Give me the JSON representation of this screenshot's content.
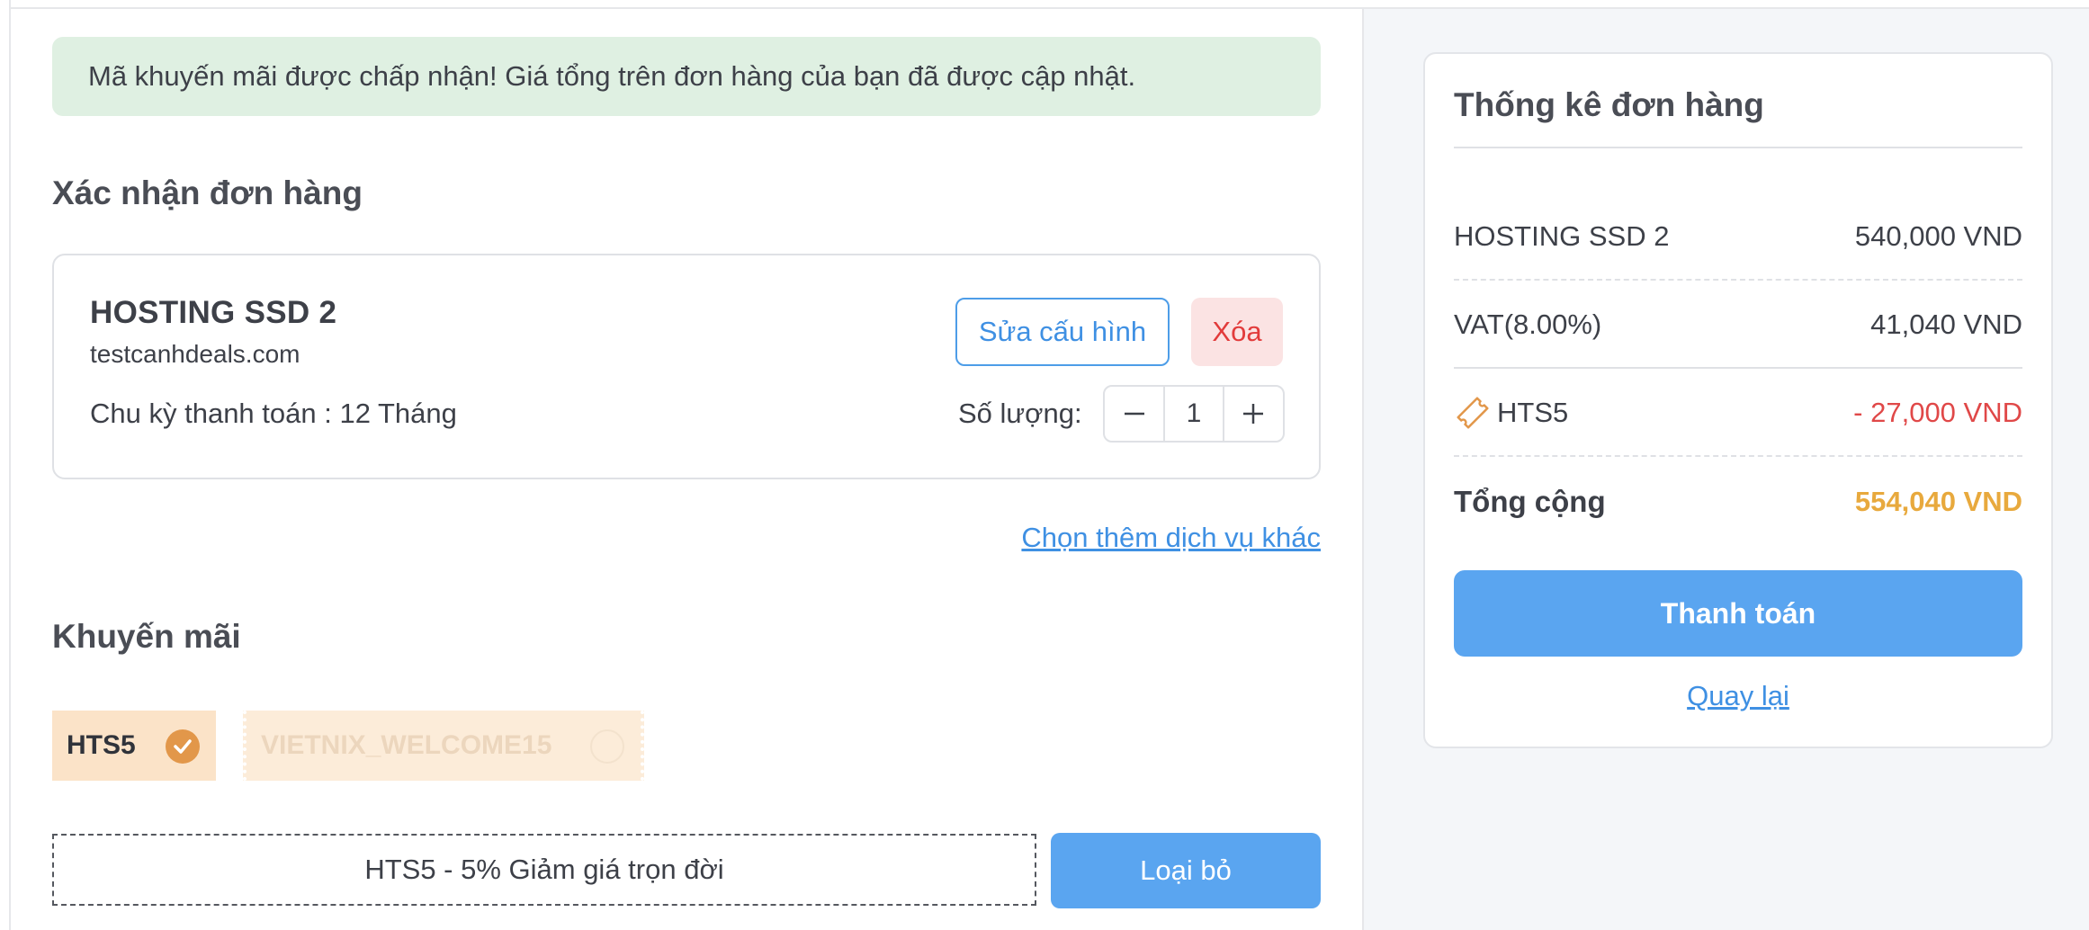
{
  "alert": {
    "message": "Mã khuyến mãi được chấp nhận! Giá tổng trên đơn hàng của bạn đã được cập nhật."
  },
  "confirm": {
    "title": "Xác nhận đơn hàng",
    "product": {
      "name": "HOSTING SSD 2",
      "domain": "testcanhdeals.com",
      "cycle": "Chu kỳ thanh toán : 12 Tháng",
      "edit_label": "Sửa cấu hình",
      "delete_label": "Xóa",
      "quantity_label": "Số lượng:",
      "quantity": "1"
    },
    "more_services": "Chọn thêm dịch vụ khác"
  },
  "promo": {
    "title": "Khuyến mãi",
    "coupons": [
      {
        "code": "HTS5",
        "selected": true
      },
      {
        "code": "VIETNIX_WELCOME15",
        "selected": false
      }
    ],
    "applied_description": "HTS5 - 5% Giảm giá trọn đời",
    "remove_label": "Loại bỏ"
  },
  "summary": {
    "title": "Thống kê đơn hàng",
    "lines": [
      {
        "label": "HOSTING SSD 2",
        "value": "540,000 VND"
      },
      {
        "label": "VAT(8.00%)",
        "value": "41,040 VND"
      },
      {
        "label": "HTS5",
        "value": "- 27,000 VND"
      }
    ],
    "total_label": "Tổng cộng",
    "total_value": "554,040 VND",
    "pay_label": "Thanh toán",
    "back_label": "Quay lại"
  },
  "colors": {
    "accent": "#5aa5f0",
    "success_bg": "#dff0e2",
    "danger": "#e04848",
    "total": "#e8a93d",
    "coupon_bg": "#fbe3c8",
    "coupon_check": "#e2974a"
  },
  "icons": [
    "minus-icon",
    "plus-icon",
    "check-icon",
    "ticket-icon"
  ]
}
